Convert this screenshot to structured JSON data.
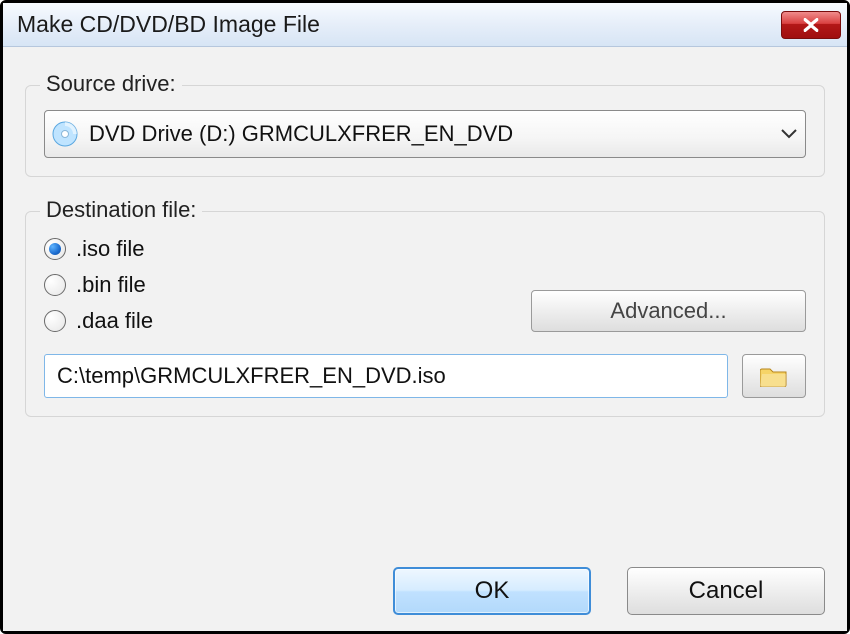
{
  "window": {
    "title": "Make CD/DVD/BD Image File"
  },
  "source": {
    "legend": "Source drive:",
    "selected": "DVD Drive (D:) GRMCULXFRER_EN_DVD"
  },
  "destination": {
    "legend": "Destination file:",
    "options": [
      {
        "label": ".iso file",
        "checked": true
      },
      {
        "label": ".bin file",
        "checked": false
      },
      {
        "label": ".daa file",
        "checked": false
      }
    ],
    "advanced_label": "Advanced...",
    "path": "C:\\temp\\GRMCULXFRER_EN_DVD.iso"
  },
  "buttons": {
    "ok": "OK",
    "cancel": "Cancel"
  }
}
